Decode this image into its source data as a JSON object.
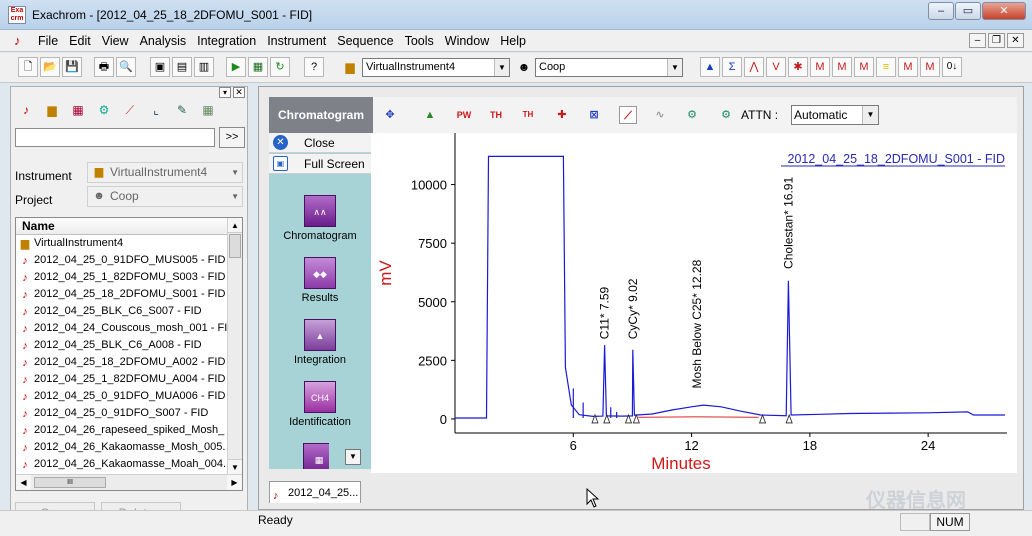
{
  "window": {
    "title": "Exachrom - [2012_04_25_18_2DFOMU_S001 - FID]",
    "controls": [
      "‒",
      "▭",
      "✕"
    ]
  },
  "menu": {
    "items": [
      "File",
      "Edit",
      "View",
      "Analysis",
      "Integration",
      "Instrument",
      "Sequence",
      "Tools",
      "Window",
      "Help"
    ],
    "mdi_controls": [
      "‒",
      "❐",
      "✕"
    ]
  },
  "toolbar": {
    "instrument_value": "VirtualInstrument4",
    "project_value": "Coop"
  },
  "left_panel": {
    "search_button": ">>",
    "instrument_label": "Instrument",
    "instrument_value": "VirtualInstrument4",
    "project_label": "Project",
    "project_value": "Coop",
    "list_header": "Name",
    "items": [
      "VirtualInstrument4",
      "2012_04_25_0_91DFO_MUS005 - FID",
      "2012_04_25_1_82DFOMU_S003 - FID",
      "2012_04_25_18_2DFOMU_S001 - FID",
      "2012_04_25_BLK_C6_S007 - FID",
      "2012_04_24_Couscous_mosh_001 - FI",
      "2012_04_25_BLK_C6_A008 - FID",
      "2012_04_25_18_2DFOMU_A002 - FID",
      "2012_04_25_1_82DFOMU_A004 - FID",
      "2012_04_25_0_91DFO_MUA006 - FID",
      "2012_04_25_0_91DFO_S007 - FID",
      "2012_04_26_rapeseed_spiked_Mosh_",
      "2012_04_26_Kakaomasse_Mosh_005.",
      "2012_04_26_Kakaomasse_Moah_004."
    ],
    "hscroll_thumb": "III",
    "open_button": "Open",
    "delete_button": "Delete..."
  },
  "view_toolbar": {
    "title": "Chromatogram",
    "attn_label": "ATTN :",
    "attn_value": "Automatic"
  },
  "view_sidebar": {
    "close_label": "Close",
    "fullscreen_label": "Full Screen",
    "items": [
      {
        "label": "Chromatogram"
      },
      {
        "label": "Results"
      },
      {
        "label": "Integration"
      },
      {
        "label": "Identification",
        "badge": "CH4"
      }
    ]
  },
  "chart_data": {
    "type": "line",
    "title": "2012_04_25_18_2DFOMU_S001 - FID",
    "xlabel": "Minutes",
    "ylabel": "mV",
    "xlim": [
      0,
      28
    ],
    "ylim": [
      -600,
      12200
    ],
    "xticks": [
      6,
      12,
      18,
      24
    ],
    "yticks": [
      0,
      2500,
      5000,
      7500,
      10000
    ],
    "peak_labels": [
      {
        "x": 7.59,
        "text": "C11* 7.59"
      },
      {
        "x": 9.02,
        "text": "CyCy* 9.02"
      },
      {
        "x": 12.28,
        "text": "Mosh Below C25* 12.28"
      },
      {
        "x": 16.91,
        "text": "Cholestan* 16.91"
      }
    ],
    "series": [
      {
        "color": "#1a1ad6",
        "points": [
          [
            0,
            40
          ],
          [
            1.6,
            40
          ],
          [
            1.7,
            11200
          ],
          [
            5.5,
            11200
          ],
          [
            5.6,
            2200
          ],
          [
            5.9,
            600
          ],
          [
            6.3,
            180
          ],
          [
            7.0,
            110
          ],
          [
            7.5,
            120
          ],
          [
            7.59,
            3150
          ],
          [
            7.68,
            130
          ],
          [
            8.5,
            120
          ],
          [
            9.0,
            130
          ],
          [
            9.02,
            2950
          ],
          [
            9.1,
            160
          ],
          [
            10.0,
            210
          ],
          [
            11.0,
            380
          ],
          [
            12.0,
            520
          ],
          [
            12.6,
            590
          ],
          [
            13.5,
            520
          ],
          [
            14.5,
            330
          ],
          [
            15.5,
            170
          ],
          [
            16.8,
            140
          ],
          [
            16.91,
            5900
          ],
          [
            17.05,
            170
          ],
          [
            18.5,
            200
          ],
          [
            20.0,
            230
          ],
          [
            24.0,
            260
          ],
          [
            26.0,
            300
          ],
          [
            26.3,
            170
          ],
          [
            27.9,
            170
          ]
        ]
      },
      {
        "color": "#e04040",
        "points": [
          [
            9.3,
            70
          ],
          [
            12.3,
            90
          ],
          [
            15.4,
            70
          ]
        ]
      }
    ],
    "markers_x": [
      7.1,
      7.7,
      8.8,
      9.2,
      15.6,
      16.95
    ]
  },
  "document_tab": {
    "label": "2012_04_25..."
  },
  "status": {
    "text": "Ready",
    "num": "NUM"
  },
  "watermark": {
    "text": "仪器信息网"
  }
}
